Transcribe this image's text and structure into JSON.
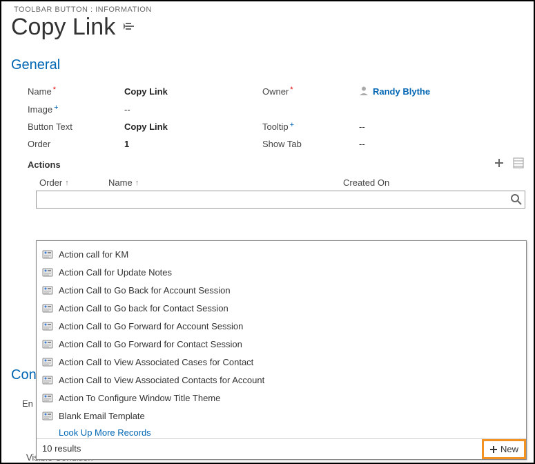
{
  "header": {
    "caption": "TOOLBAR BUTTON : INFORMATION",
    "title": "Copy Link"
  },
  "sections": {
    "general": "General",
    "conditions_partial": "Con"
  },
  "form": {
    "name_label": "Name",
    "name_value": "Copy Link",
    "owner_label": "Owner",
    "owner_value": "Randy Blythe",
    "image_label": "Image",
    "image_value": "--",
    "button_text_label": "Button Text",
    "button_text_value": "Copy Link",
    "tooltip_label": "Tooltip",
    "tooltip_value": "--",
    "order_label": "Order",
    "order_value": "1",
    "show_tab_label": "Show Tab",
    "show_tab_value": "--",
    "visible_condition_label": "Visible Condition",
    "visible_condition_value": "--",
    "enable_label_partial": "En"
  },
  "actions": {
    "label": "Actions",
    "columns": {
      "order": "Order",
      "name": "Name",
      "created": "Created On"
    }
  },
  "lookup": {
    "value": "",
    "results": [
      "Action call for KM",
      "Action Call for Update Notes",
      "Action Call to Go Back for Account Session",
      "Action Call to Go back for Contact Session",
      "Action Call to Go Forward for Account Session",
      "Action Call to Go Forward for Contact Session",
      "Action Call to View Associated Cases for Contact",
      "Action Call to View Associated Contacts for Account",
      "Action To Configure Window Title Theme",
      "Blank Email Template"
    ],
    "more_link": "Look Up More Records",
    "results_count": "10 results",
    "new_label": "New"
  }
}
